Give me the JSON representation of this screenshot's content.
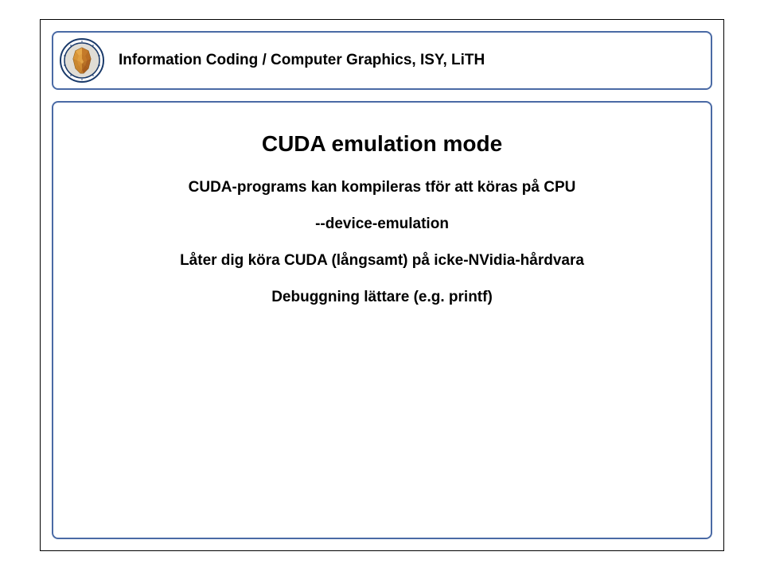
{
  "header": {
    "text": "Information Coding / Computer Graphics, ISY, LiTH"
  },
  "content": {
    "title": "CUDA emulation mode",
    "lines": [
      "CUDA-programs kan kompileras tför att köras på CPU",
      "--device-emulation",
      "Låter dig köra CUDA (långsamt) på icke-NVidia-hårdvara",
      "Debuggning lättare (e.g. printf)"
    ]
  }
}
